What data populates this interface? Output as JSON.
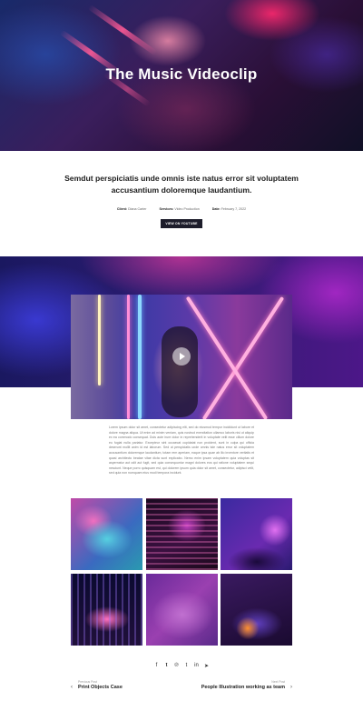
{
  "hero": {
    "title": "The Music Videoclip"
  },
  "intro": {
    "lead": "Semdut perspiciatis unde omnis iste natus error sit voluptatem accusantium doloremque laudantium.",
    "meta": [
      {
        "label": "Client:",
        "value": "Diana Carter"
      },
      {
        "label": "Services:",
        "value": "Video Production"
      },
      {
        "label": "Date:",
        "value": "February 7, 2022"
      }
    ],
    "button": "VIEW ON YOUTUBE"
  },
  "article": {
    "text": "Lorem ipsum dolor sit amet, consectetur adipiscing elit, sed do eiusmod tempor incididunt ut labore et dolore magna aliqua. Ut enim ad minim veniam, quis nostrud exercitation ullamco laboris nisi ut aliquip ex ea commodo consequat. Duis aute irure dolor in reprehenderit in voluptate velit esse cillum dolore eu fugiat nulla pariatur. Excepteur sint occaecat cupidatat non proident, sunt in culpa qui officia deserunt mollit anim id est laborum. Sed ut perspiciatis unde omnis iste natus error sit voluptatem accusantium doloremque laudantium, totam rem aperiam, eaque ipsa quae ab illo inventore veritatis et quasi architecto beatae vitae dicta sunt explicabo. Nemo enim ipsam voluptatem quia voluptas sit aspernatur aut odit aut fugit, sed quia consequuntur magni dolores eos qui ratione voluptatem sequi nesciunt. Neque porro quisquam est, qui dolorem ipsum quia dolor sit amet, consectetur, adipisci velit, sed quia non numquam eius modi tempora incidunt."
  },
  "share": {
    "icons": [
      "f",
      "t",
      "p",
      "t",
      "in",
      "send"
    ]
  },
  "nav": {
    "prev_small": "Previous Post",
    "prev_title": "Print Objects Case",
    "next_small": "Next Post",
    "next_title": "People Illustration working as team"
  }
}
